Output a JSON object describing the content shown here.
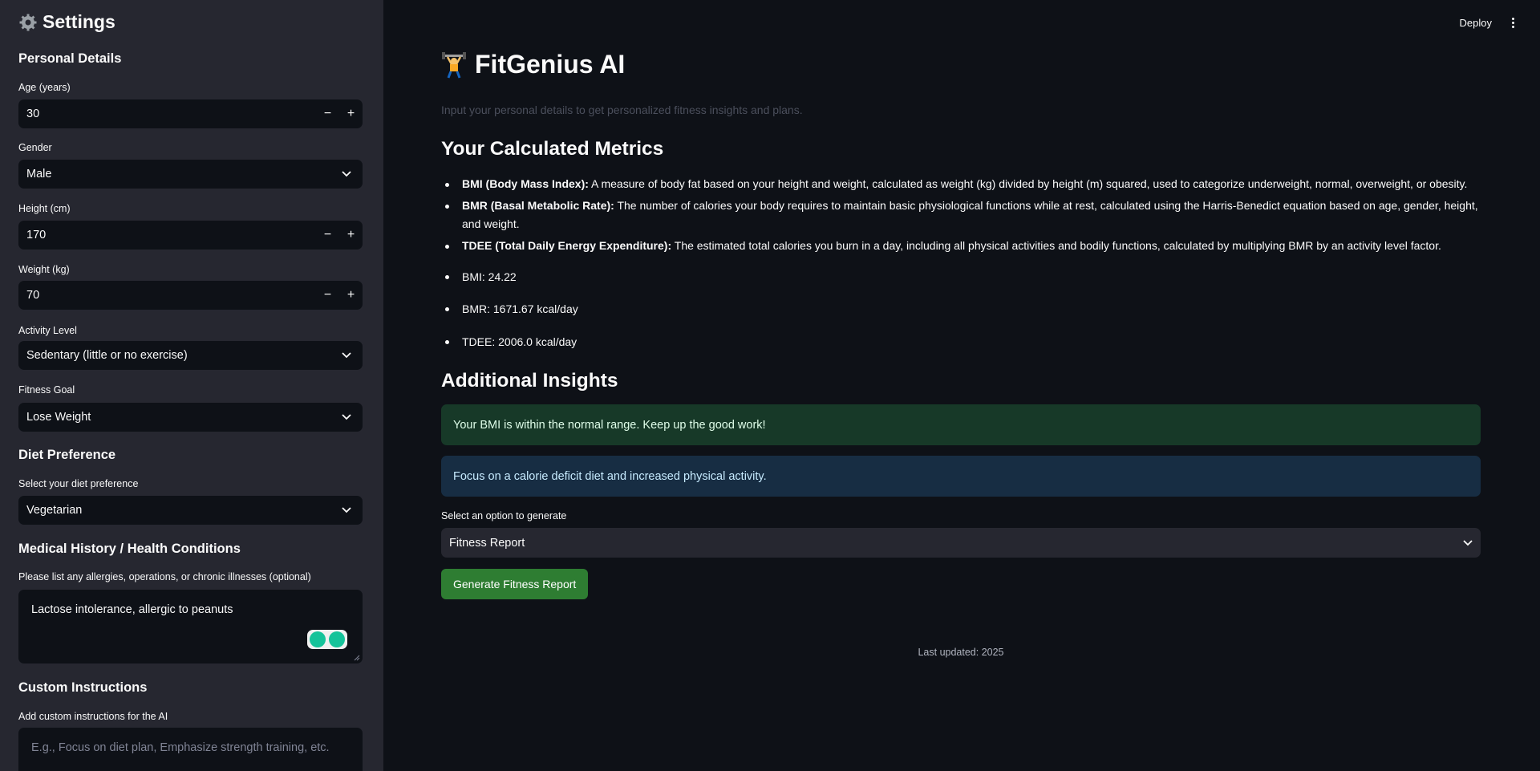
{
  "sidebar": {
    "title": "Settings",
    "personal_details_heading": "Personal Details",
    "age": {
      "label": "Age (years)",
      "value": "30"
    },
    "gender": {
      "label": "Gender",
      "value": "Male"
    },
    "height": {
      "label": "Height (cm)",
      "value": "170"
    },
    "weight": {
      "label": "Weight (kg)",
      "value": "70"
    },
    "activity": {
      "label": "Activity Level",
      "value": "Sedentary (little or no exercise)"
    },
    "goal": {
      "label": "Fitness Goal",
      "value": "Lose Weight"
    },
    "diet_heading": "Diet Preference",
    "diet": {
      "label": "Select your diet preference",
      "value": "Vegetarian"
    },
    "medical_heading": "Medical History / Health Conditions",
    "medical": {
      "label": "Please list any allergies, operations, or chronic illnesses (optional)",
      "value": "Lactose intolerance, allergic to peanuts"
    },
    "custom_heading": "Custom Instructions",
    "custom": {
      "label": "Add custom instructions for the AI",
      "placeholder": "E.g., Focus on diet plan, Emphasize strength training, etc."
    },
    "stepper_minus": "−",
    "stepper_plus": "+"
  },
  "header": {
    "deploy_label": "Deploy"
  },
  "main": {
    "title": "FitGenius AI",
    "subtitle": "Input your personal details to get personalized fitness insights and plans.",
    "metrics_heading": "Your Calculated Metrics",
    "definitions": [
      {
        "term": "BMI (Body Mass Index):",
        "text": " A measure of body fat based on your height and weight, calculated as weight (kg) divided by height (m) squared, used to categorize underweight, normal, overweight, or obesity."
      },
      {
        "term": "BMR (Basal Metabolic Rate):",
        "text": " The number of calories your body requires to maintain basic physiological functions while at rest, calculated using the Harris-Benedict equation based on age, gender, height, and weight."
      },
      {
        "term": "TDEE (Total Daily Energy Expenditure):",
        "text": " The estimated total calories you burn in a day, including all physical activities and bodily functions, calculated by multiplying BMR by an activity level factor."
      }
    ],
    "metrics": [
      "BMI: 24.22",
      "BMR: 1671.67 kcal/day",
      "TDEE: 2006.0 kcal/day"
    ],
    "insights_heading": "Additional Insights",
    "success_msg": "Your BMI is within the normal range. Keep up the good work!",
    "info_msg": "Focus on a calorie deficit diet and increased physical activity.",
    "option_label": "Select an option to generate",
    "option_value": "Fitness Report",
    "generate_button": "Generate Fitness Report",
    "footer": "Last updated: 2025"
  },
  "colors": {
    "success": "#173928",
    "info": "#172d43",
    "button": "#2e7d32",
    "sidebar": "#262730",
    "background": "#0e1117"
  }
}
